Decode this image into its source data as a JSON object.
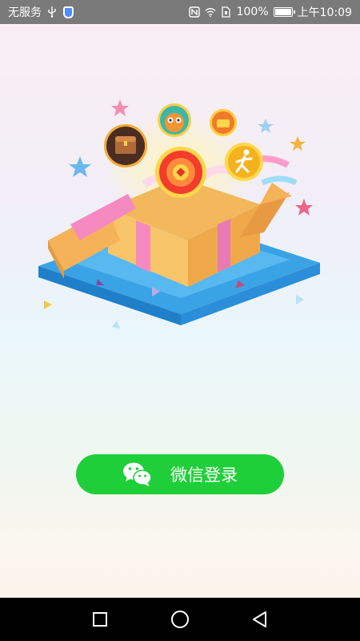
{
  "status_bar": {
    "carrier": "无服务",
    "battery_text": "100%",
    "battery_level": 1.0,
    "time": "上午10:09",
    "icons": [
      "usb-icon",
      "shield-icon",
      "nfc-icon",
      "wifi-icon",
      "sim-icon",
      "battery-icon"
    ]
  },
  "illustration": {
    "icons": [
      "treasure-chest-icon",
      "monkey-icon",
      "wallet-icon",
      "coin-wheel-icon",
      "runner-icon",
      "gift-box-icon"
    ]
  },
  "login": {
    "wechat_label": "微信登录",
    "button_color": "#1fcf3a"
  },
  "nav_bar": {
    "icons": [
      "square-recents-icon",
      "circle-home-icon",
      "triangle-back-icon"
    ]
  }
}
